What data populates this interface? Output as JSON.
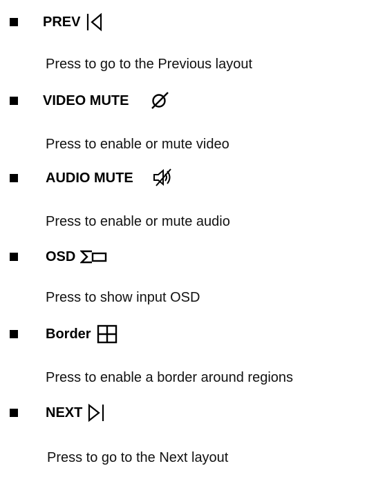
{
  "items": [
    {
      "label": "PREV",
      "icon": "previous-layout-icon",
      "description": "Press to go to the Previous layout"
    },
    {
      "label": "VIDEO MUTE",
      "icon": "video-mute-icon",
      "description": "Press to enable or mute video"
    },
    {
      "label": "AUDIO MUTE",
      "icon": "audio-mute-icon",
      "description": "Press to enable or mute audio"
    },
    {
      "label": "OSD",
      "icon": "osd-icon",
      "description": "Press to show input OSD"
    },
    {
      "label": "Border",
      "icon": "border-grid-icon",
      "description": "Press to enable a border around regions"
    },
    {
      "label": "NEXT",
      "icon": "next-layout-icon",
      "description": "Press to go to the Next layout"
    }
  ]
}
